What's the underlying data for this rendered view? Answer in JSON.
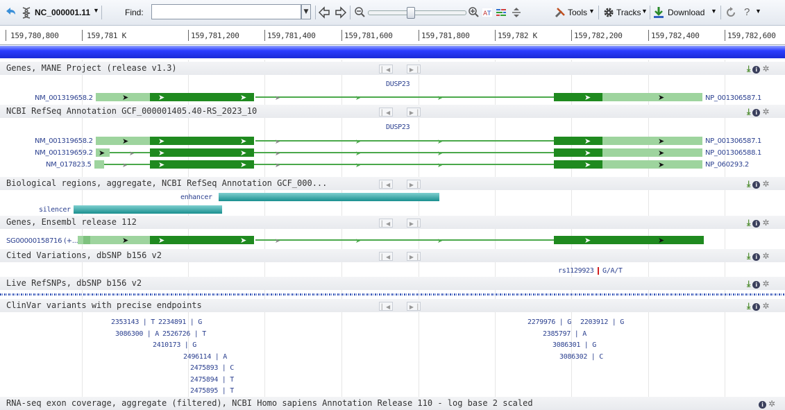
{
  "toolbar": {
    "sequence_id": "NC_000001.11",
    "find_label": "Find:",
    "find_value": "",
    "tools_label": "Tools",
    "tracks_label": "Tracks",
    "download_label": "Download",
    "help_label": "?"
  },
  "ruler": {
    "ticks": [
      "159,780,800",
      "159,781 K",
      "159,781,200",
      "159,781,400",
      "159,781,600",
      "159,781,800",
      "159,782 K",
      "159,782,200",
      "159,782,400",
      "159,782,600"
    ]
  },
  "tracks": {
    "mane": {
      "title": "Genes, MANE Project (release v1.3)",
      "gene_name": "DUSP23",
      "transcript": "NM_001319658.2",
      "protein": "NP_001306587.1"
    },
    "refseq": {
      "title": "NCBI RefSeq Annotation GCF_000001405.40-RS_2023_10",
      "gene_name": "DUSP23",
      "rows": [
        {
          "transcript": "NM_001319658.2",
          "protein": "NP_001306587.1"
        },
        {
          "transcript": "NM_001319659.2",
          "protein": "NP_001306588.1"
        },
        {
          "transcript": "NM_017823.5",
          "protein": "NP_060293.2"
        }
      ]
    },
    "bioregions": {
      "title": "Biological regions, aggregate, NCBI RefSeq Annotation GCF_000...",
      "enhancer_label": "enhancer",
      "silencer_label": "silencer"
    },
    "ensembl": {
      "title": "Genes, Ensembl release 112",
      "transcript": "SG00000158716 (+..."
    },
    "cited": {
      "title": "Cited Variations, dbSNP b156 v2",
      "variant": "rs1129923",
      "alleles": "G/A/T"
    },
    "live": {
      "title": "Live RefSNPs, dbSNP b156 v2"
    },
    "clinvar": {
      "title": "ClinVar variants with precise endpoints",
      "variants": [
        {
          "id": "2353143",
          "allele": "T"
        },
        {
          "id": "2234891",
          "allele": "G"
        },
        {
          "id": "3086300",
          "allele": "A"
        },
        {
          "id": "2526726",
          "allele": "T"
        },
        {
          "id": "2410173",
          "allele": "G"
        },
        {
          "id": "2496114",
          "allele": "A"
        },
        {
          "id": "2475893",
          "allele": "C"
        },
        {
          "id": "2475894",
          "allele": "T"
        },
        {
          "id": "2475895",
          "allele": "T"
        },
        {
          "id": "2279976",
          "allele": "G"
        },
        {
          "id": "2203912",
          "allele": "G"
        },
        {
          "id": "2385797",
          "allele": "A"
        },
        {
          "id": "3086301",
          "allele": "G"
        },
        {
          "id": "3086302",
          "allele": "C"
        }
      ]
    },
    "rnaseq": {
      "title": "RNA-seq exon coverage, aggregate (filtered), NCBI Homo sapiens Annotation Release 110 - log base 2 scaled"
    }
  },
  "colors": {
    "exon_dark": "#1f8a1f",
    "exon_light": "#9ed49e",
    "intron": "#4aa84a",
    "regulatory": "#2a9a9a",
    "seqbar": "#2b3dff"
  }
}
